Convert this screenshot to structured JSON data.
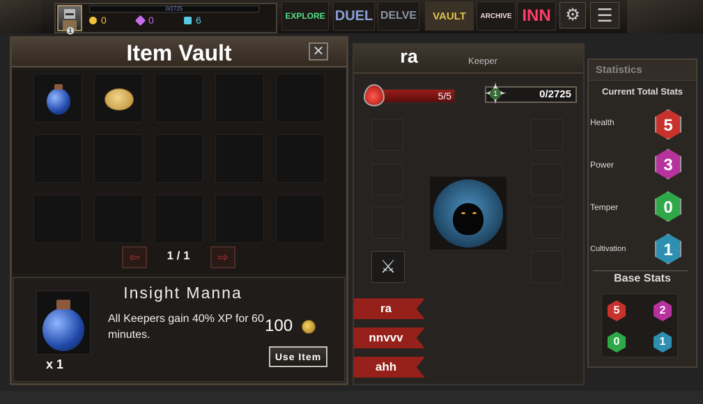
{
  "hud": {
    "player_level": "1",
    "xp_text": "0/2725",
    "gold": "0",
    "gems": "0",
    "crystals": "6"
  },
  "nav": {
    "explore": "EXPLORE",
    "duel": "DUEL",
    "delve": "DELVE",
    "vault": "VAULT",
    "archive": "ARCHIVE",
    "inn": "INN"
  },
  "vault": {
    "title": "Item Vault",
    "close_label": "✕",
    "page_text": "1 / 1",
    "prev_label": "⇦",
    "next_label": "⇨"
  },
  "selected_item": {
    "name": "Insight Manna",
    "description": "All Keepers gain 40% XP for 60 minutes.",
    "count": "x 1",
    "price": "100",
    "use_label": "Use Item"
  },
  "keeper": {
    "name": "ra",
    "role": "Keeper",
    "health_text": "5/5",
    "level": "1",
    "xp_text": "0/2725",
    "roster": [
      "ra",
      "nnvvv",
      "ahh"
    ]
  },
  "stats": {
    "title": "Statistics",
    "current_title": "Current Total Stats",
    "rows": [
      {
        "label": "Health",
        "value": "5",
        "color": "#c8322c"
      },
      {
        "label": "Power",
        "value": "3",
        "color": "#b8329e"
      },
      {
        "label": "Temper",
        "value": "0",
        "color": "#2fa84a"
      },
      {
        "label": "Cultivation",
        "value": "1",
        "color": "#2e8fb0"
      }
    ],
    "base_title": "Base Stats",
    "base": [
      "5",
      "2",
      "0",
      "1"
    ]
  }
}
